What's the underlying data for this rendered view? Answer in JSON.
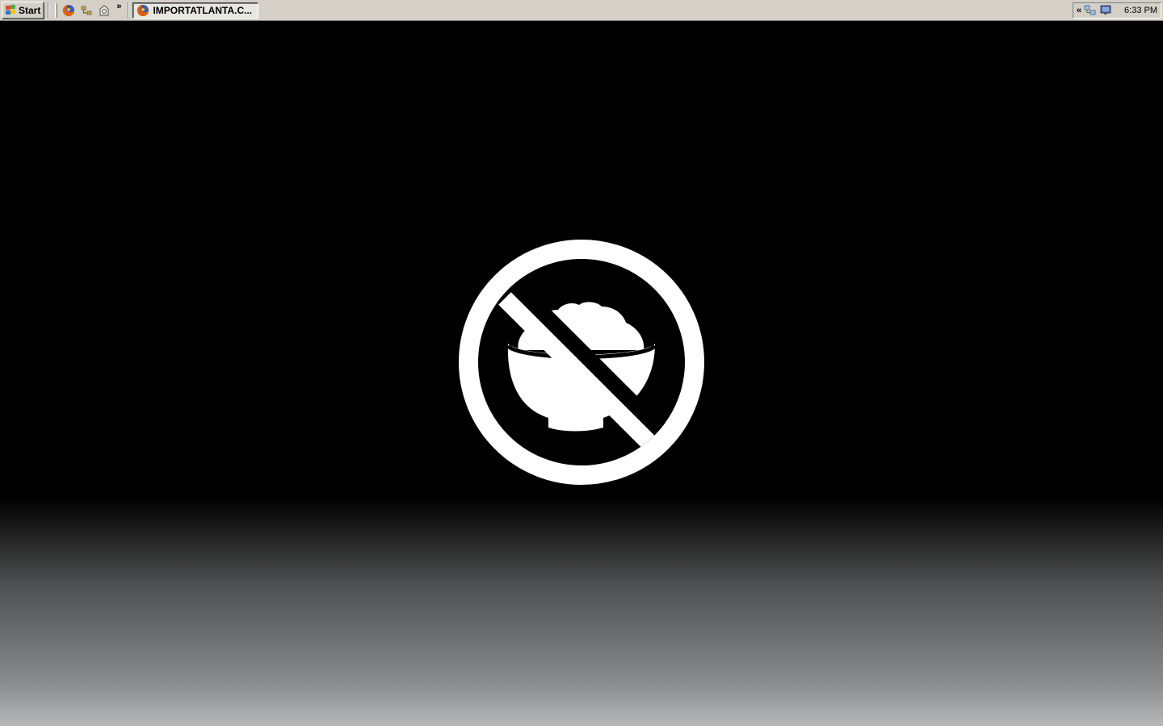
{
  "taskbar": {
    "start_label": "Start",
    "quick_launch": [
      {
        "icon": "firefox-icon"
      },
      {
        "icon": "network-icon"
      },
      {
        "icon": "web-server-icon"
      }
    ],
    "quick_launch_more": "»",
    "tasks": [
      {
        "icon": "firefox-icon",
        "label": "IMPORTATLANTA.C..."
      }
    ],
    "tray": {
      "expand_label": "«",
      "icons": [
        "network-connection-icon",
        "display-icon"
      ],
      "clock": "6:33 PM"
    }
  },
  "desktop": {
    "wallpaper": "no-rice-bowl-prohibition-sign"
  },
  "colors": {
    "taskbar": "#d4d0c8",
    "desktop": "#000000",
    "sign": "#ffffff"
  }
}
